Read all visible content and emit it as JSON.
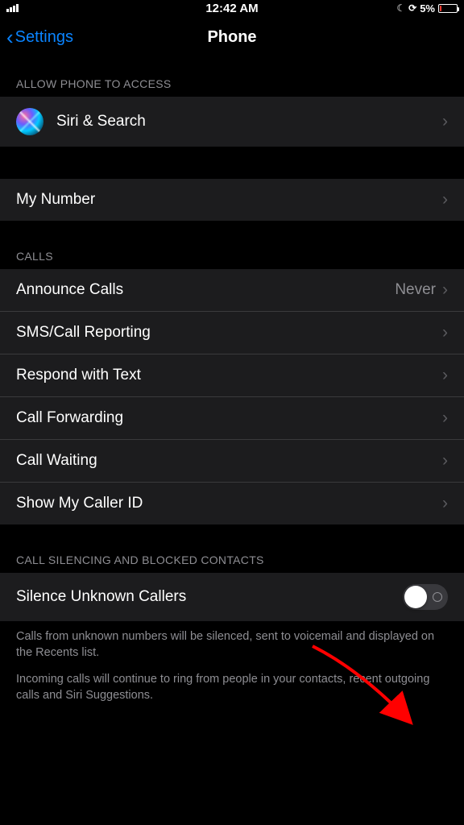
{
  "status_bar": {
    "time": "12:42 AM",
    "battery_percent": "5%"
  },
  "nav": {
    "back_label": "Settings",
    "title": "Phone"
  },
  "sections": {
    "allow_access": {
      "header": "ALLOW PHONE TO ACCESS",
      "siri_label": "Siri & Search"
    },
    "my_number": {
      "label": "My Number"
    },
    "calls": {
      "header": "CALLS",
      "items": [
        {
          "label": "Announce Calls",
          "value": "Never"
        },
        {
          "label": "SMS/Call Reporting",
          "value": ""
        },
        {
          "label": "Respond with Text",
          "value": ""
        },
        {
          "label": "Call Forwarding",
          "value": ""
        },
        {
          "label": "Call Waiting",
          "value": ""
        },
        {
          "label": "Show My Caller ID",
          "value": ""
        }
      ]
    },
    "silencing": {
      "header": "CALL SILENCING AND BLOCKED CONTACTS",
      "toggle_label": "Silence Unknown Callers",
      "footer1": "Calls from unknown numbers will be silenced, sent to voicemail and displayed on the Recents list.",
      "footer2": "Incoming calls will continue to ring from people in your contacts, recent outgoing calls and Siri Suggestions."
    }
  }
}
